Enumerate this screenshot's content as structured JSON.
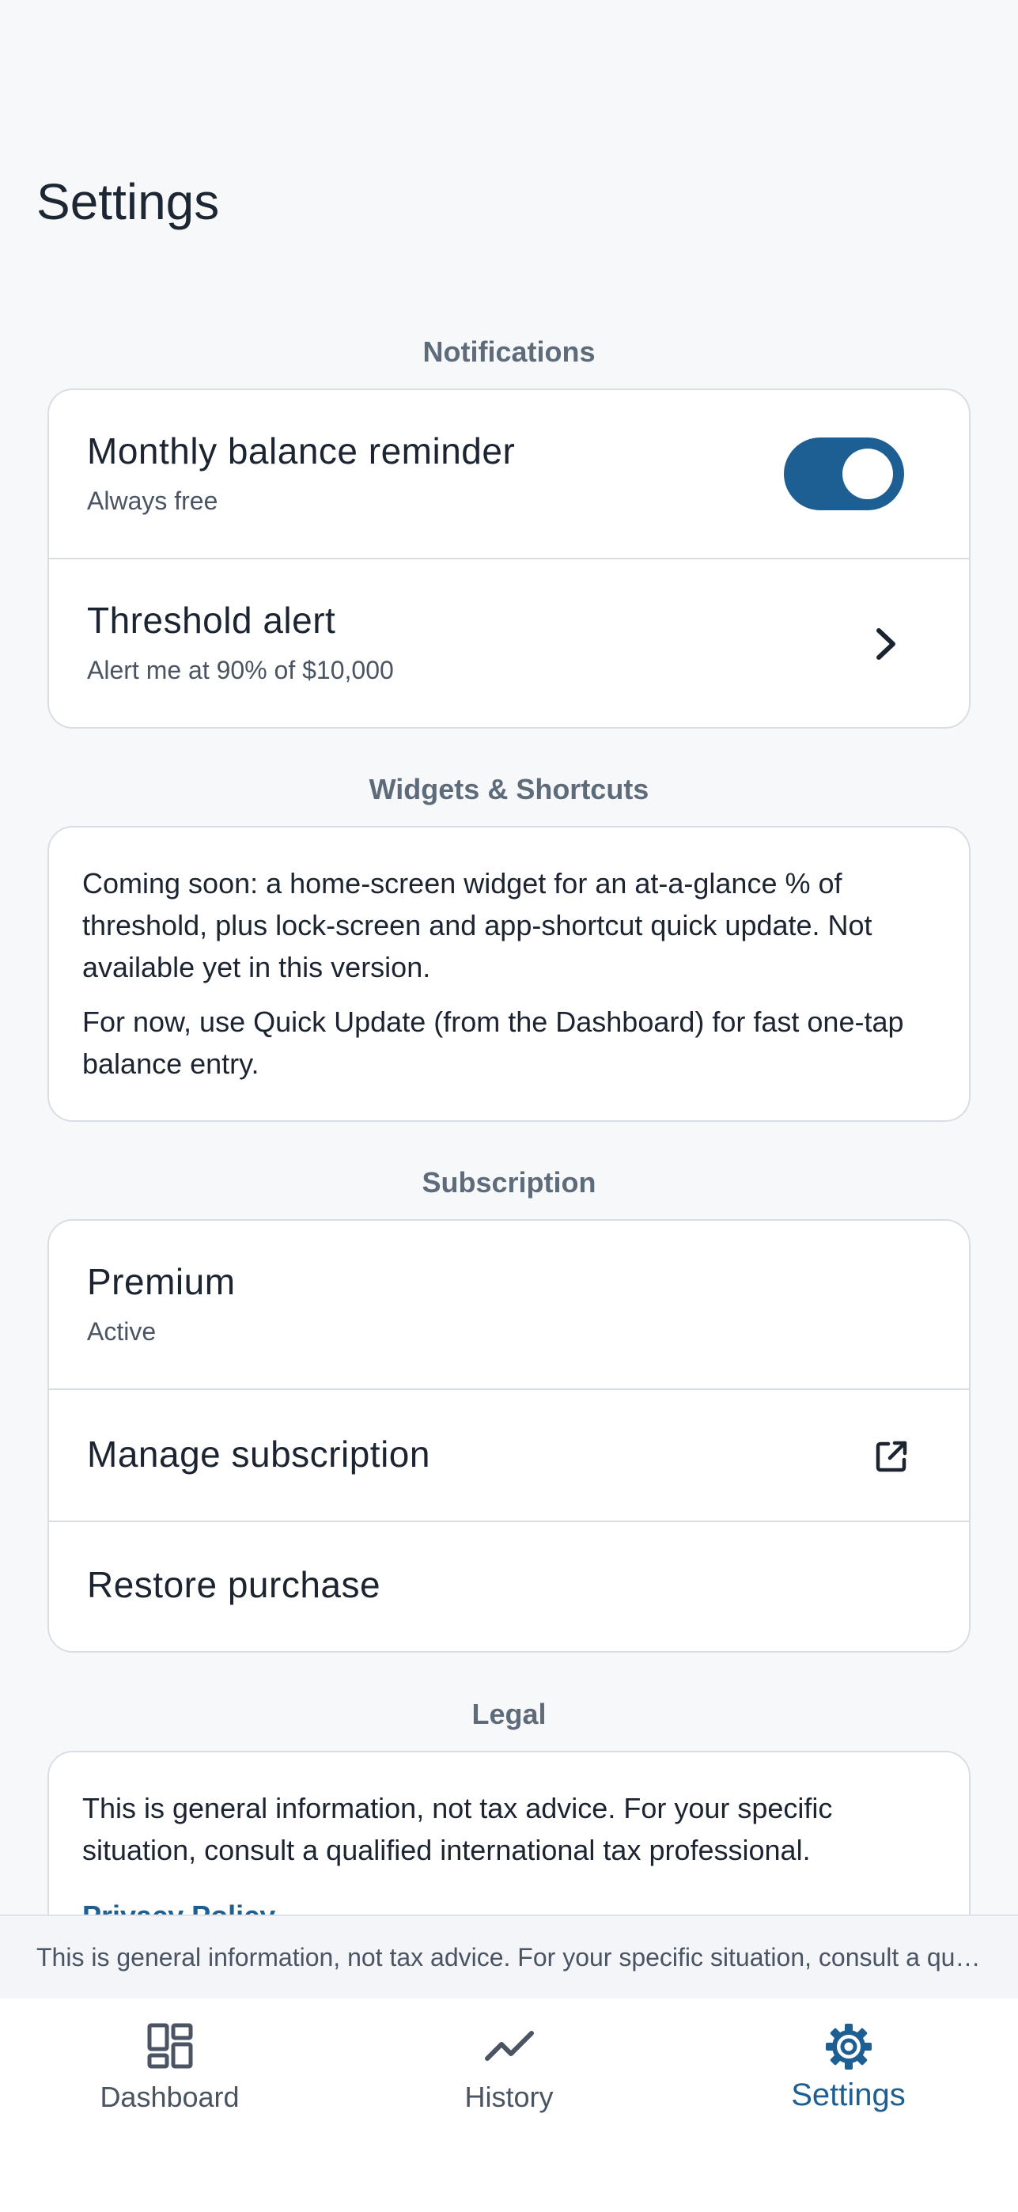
{
  "header": {
    "title": "Settings"
  },
  "sections": {
    "notifications": {
      "header": "Notifications",
      "monthly_reminder": {
        "title": "Monthly balance reminder",
        "subtitle": "Always free",
        "enabled": true
      },
      "threshold_alert": {
        "title": "Threshold alert",
        "subtitle": "Alert me at 90% of $10,000"
      }
    },
    "widgets": {
      "header": "Widgets & Shortcuts",
      "paragraph1": "Coming soon: a home-screen widget for an at-a-glance % of threshold, plus lock-screen and app-shortcut quick update. Not available yet in this version.",
      "paragraph2": "For now, use Quick Update (from the Dashboard) for fast one-tap balance entry."
    },
    "subscription": {
      "header": "Subscription",
      "plan": {
        "title": "Premium",
        "status": "Active"
      },
      "manage_label": "Manage subscription",
      "restore_label": "Restore purchase"
    },
    "legal": {
      "header": "Legal",
      "text": "This is general information, not tax advice. For your specific situation, consult a qualified international tax professional.",
      "privacy_link": "Privacy Policy"
    }
  },
  "disclaimer_bar": {
    "text": "This is general information, not tax advice. For your specific situation, consult a qualified international tax professional."
  },
  "tabbar": {
    "tabs": [
      {
        "label": "Dashboard",
        "icon": "dashboard-icon",
        "active": false
      },
      {
        "label": "History",
        "icon": "history-icon",
        "active": false
      },
      {
        "label": "Settings",
        "icon": "gear-icon",
        "active": true
      }
    ]
  },
  "colors": {
    "accent": "#1e5f93",
    "background": "#f7f8fa",
    "card": "#ffffff",
    "border": "#d9dee5",
    "muted_text": "#5e6b7a"
  }
}
